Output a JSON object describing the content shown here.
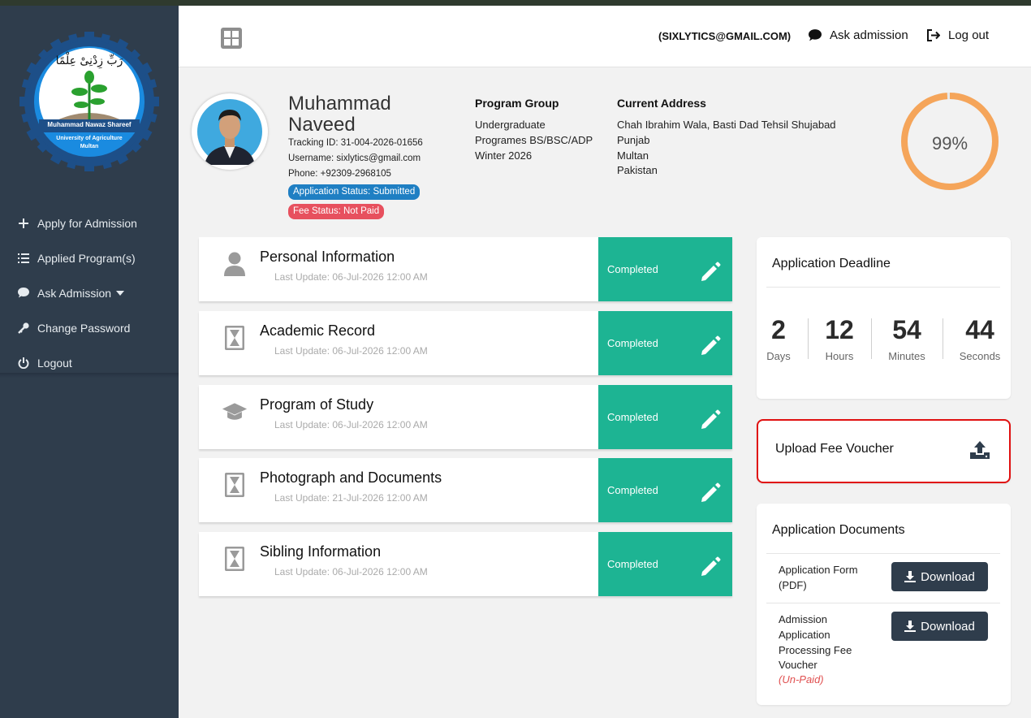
{
  "user": {
    "email_display": "(SIXLYTICS@GMAIL.COM)",
    "name": "Muhammad Naveed",
    "tracking_id": "Tracking ID: 31-004-2026-01656",
    "username": "Username: sixlytics@gmail.com",
    "phone": "Phone: +92309-2968105",
    "application_status": "Application Status: Submitted",
    "fee_status": "Fee Status: Not Paid",
    "completion_percent": 99,
    "completion_label": "99%"
  },
  "header": {
    "ask_admission": "Ask admission",
    "logout": "Log out"
  },
  "sidebar": {
    "logo_text_top": "Muhammad Nawaz Shareef",
    "logo_text_bottom_1": "University of Agriculture",
    "logo_text_bottom_2": "Multan",
    "logo_script": "رَبِّ زِدْنِیْ عِلْمًا",
    "items": [
      {
        "label": "Apply for Admission",
        "icon": "plus-icon"
      },
      {
        "label": "Applied Program(s)",
        "icon": "list-icon"
      },
      {
        "label": "Ask Admission",
        "icon": "chat-icon"
      },
      {
        "label": "Change Password",
        "icon": "key-icon"
      },
      {
        "label": "Logout",
        "icon": "power-icon"
      }
    ]
  },
  "program_group": {
    "title": "Program Group",
    "lines": [
      "Undergraduate",
      "Programes BS/BSC/ADP",
      "Winter 2026"
    ]
  },
  "current_address": {
    "title": "Current Address",
    "lines": [
      "Chah Ibrahim Wala, Basti Dad Tehsil Shujabad",
      "Punjab",
      "Multan",
      "Pakistan"
    ]
  },
  "sections": [
    {
      "title": "Personal Information",
      "updated": "Last Update: 06-Jul-2026 12:00 AM",
      "status": "Completed",
      "icon": "user-icon"
    },
    {
      "title": "Academic Record",
      "updated": "Last Update: 06-Jul-2026 12:00 AM",
      "status": "Completed",
      "icon": "hourglass-icon"
    },
    {
      "title": "Program of Study",
      "updated": "Last Update: 06-Jul-2026 12:00 AM",
      "status": "Completed",
      "icon": "graduation-cap-icon"
    },
    {
      "title": "Photograph and Documents",
      "updated": "Last Update: 21-Jul-2026 12:00 AM",
      "status": "Completed",
      "icon": "hourglass-icon"
    },
    {
      "title": "Sibling Information",
      "updated": "Last Update: 06-Jul-2026 12:00 AM",
      "status": "Completed",
      "icon": "hourglass-icon"
    }
  ],
  "deadline": {
    "title": "Application Deadline",
    "units": [
      {
        "value": "2",
        "label": "Days"
      },
      {
        "value": "12",
        "label": "Hours"
      },
      {
        "value": "54",
        "label": "Minutes"
      },
      {
        "value": "44",
        "label": "Seconds"
      }
    ]
  },
  "upload_voucher": {
    "title": "Upload Fee Voucher"
  },
  "documents": {
    "title": "Application Documents",
    "items": [
      {
        "lines": [
          "Application Form",
          "(PDF)"
        ],
        "button": "Download"
      },
      {
        "lines": [
          "Admission",
          "Application",
          "Processing Fee",
          "Voucher"
        ],
        "note": "(Un-Paid)",
        "button": "Download"
      }
    ]
  },
  "colors": {
    "sidebar_bg": "#2f3d4c",
    "completed_green": "#1db493",
    "progress_orange": "#f5a55a",
    "badge_blue": "#1f7fc3",
    "badge_red": "#e7505e",
    "upload_border": "#e01010"
  }
}
